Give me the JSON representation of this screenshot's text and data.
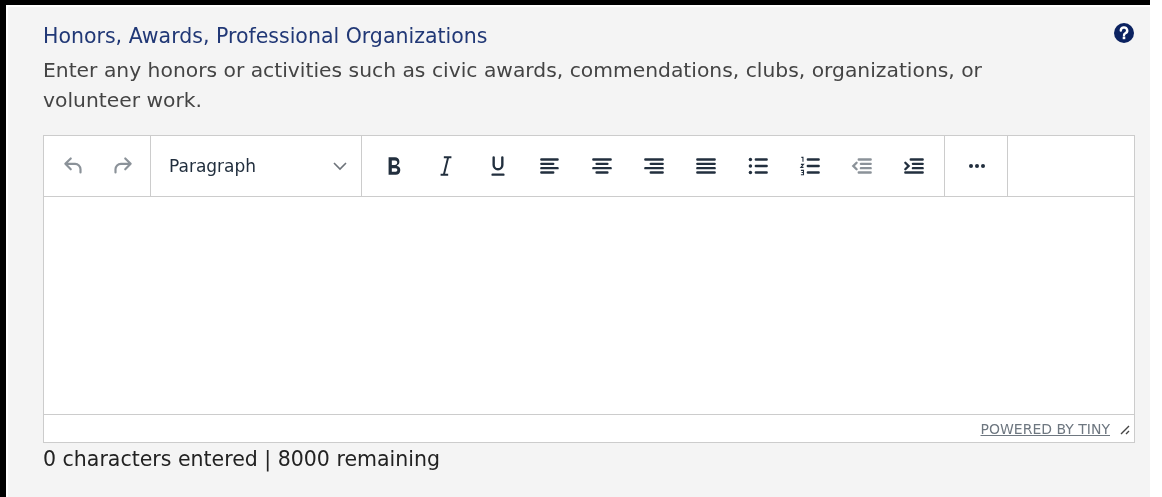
{
  "field": {
    "label": "Honors, Awards, Professional Organizations",
    "help": true,
    "description": "Enter any honors or activities such as civic awards, commendations, clubs, organizations, or volunteer work."
  },
  "editor": {
    "toolbar_groups": [
      {
        "items": [
          {
            "kind": "undo",
            "disabled": true
          },
          {
            "kind": "redo",
            "disabled": true
          }
        ]
      },
      {
        "items": [
          {
            "kind": "dropdown",
            "value": "Paragraph",
            "disabled": false
          }
        ]
      },
      {
        "items": [
          {
            "kind": "bold",
            "disabled": false
          },
          {
            "kind": "italic",
            "disabled": false
          },
          {
            "kind": "underline",
            "disabled": false
          },
          {
            "kind": "align-left",
            "disabled": false
          },
          {
            "kind": "align-center",
            "disabled": false
          },
          {
            "kind": "align-right",
            "disabled": false
          },
          {
            "kind": "justify",
            "disabled": false
          },
          {
            "kind": "bullet-list",
            "disabled": false
          },
          {
            "kind": "numbered-list",
            "disabled": false
          },
          {
            "kind": "outdent",
            "disabled": true
          },
          {
            "kind": "indent",
            "disabled": false
          }
        ]
      },
      {
        "items": [
          {
            "kind": "more",
            "disabled": false
          }
        ]
      }
    ],
    "branding": "POWERED BY TINY"
  },
  "counter": "0 characters entered | 8000 remaining"
}
